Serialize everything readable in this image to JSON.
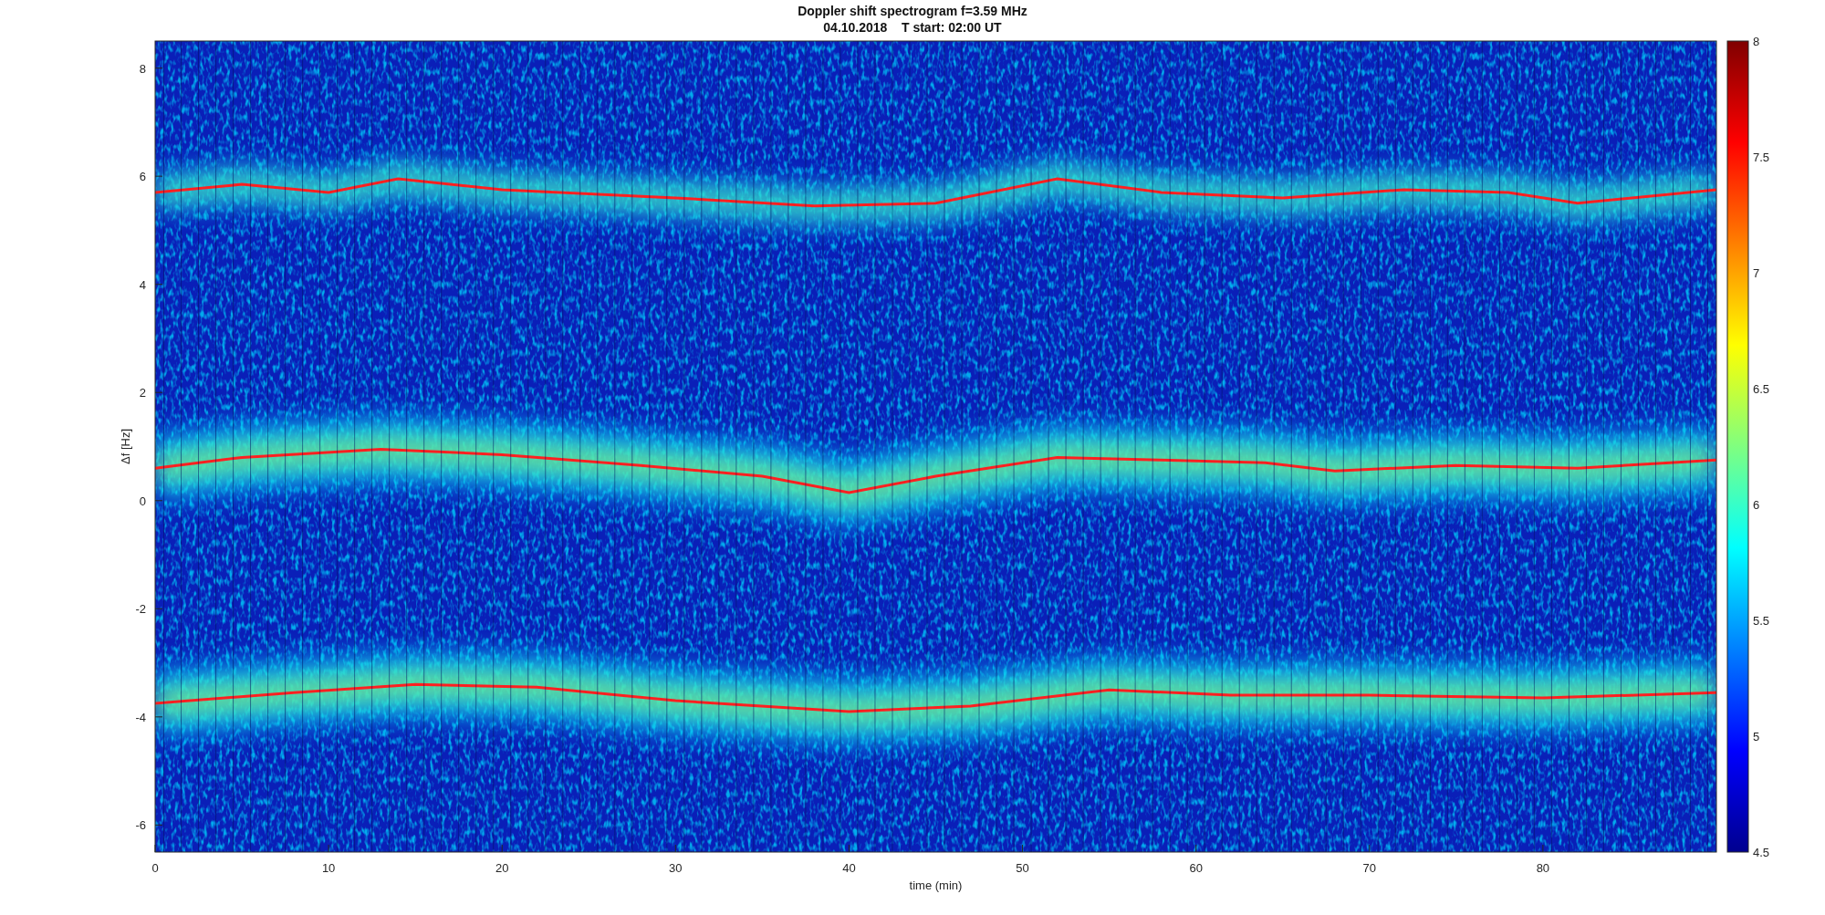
{
  "figure": {
    "title_lines": [
      "Doppler shift spectrogram f=3.59 MHz",
      "04.10.2018    T start: 02:00 UT"
    ],
    "xlabel": "time (min)",
    "ylabel": "Δf [Hz]",
    "xticks": [
      "0",
      "10",
      "20",
      "30",
      "40",
      "50",
      "60",
      "70",
      "80"
    ],
    "yticks": [
      "8",
      "6",
      "4",
      "2",
      "0",
      "-2",
      "-4",
      "-6"
    ],
    "colorbar_ticks": [
      "8",
      "7.5",
      "7",
      "6.5",
      "6",
      "5.5",
      "5",
      "4.5"
    ]
  }
}
